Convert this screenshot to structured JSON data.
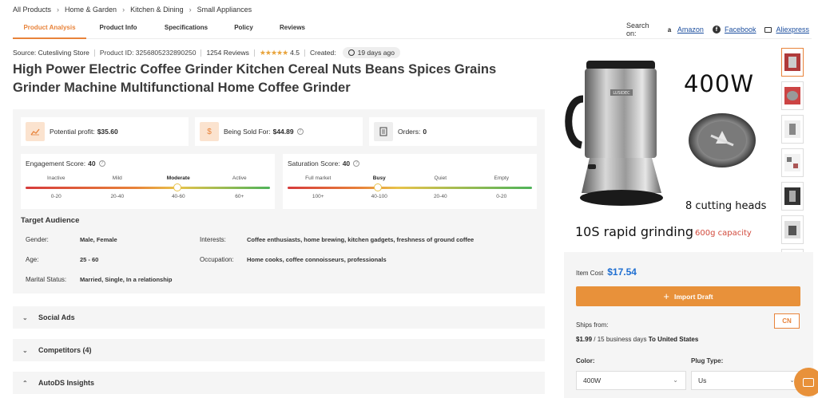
{
  "breadcrumb": [
    "All Products",
    "Home & Garden",
    "Kitchen & Dining",
    "Small Appliances"
  ],
  "tabs": [
    "Product Analysis",
    "Product Info",
    "Specifications",
    "Policy",
    "Reviews"
  ],
  "search_on": {
    "label": "Search on:",
    "links": [
      {
        "label": "Amazon",
        "icon": "amazon-icon"
      },
      {
        "label": "Facebook",
        "icon": "facebook-icon"
      },
      {
        "label": "Aliexpress",
        "icon": "mail-icon"
      }
    ]
  },
  "meta": {
    "source": "Source: Cutesliving Store",
    "product_id": "Product ID: 3256805232890250",
    "reviews": "1254 Reviews",
    "rating": "4.5",
    "stars": "★★★★★",
    "created_label": "Created:",
    "created_value": "19 days ago"
  },
  "title": "High Power Electric Coffee Grinder Kitchen Cereal Nuts Beans Spices Grains Grinder Machine Multifunctional Home Coffee Grinder",
  "stats": {
    "profit_label": "Potential profit:",
    "profit_value": "$35.60",
    "sold_label": "Being Sold For:",
    "sold_value": "$44.89",
    "orders_label": "Orders:",
    "orders_value": "0",
    "dollar_sign": "$"
  },
  "engagement": {
    "label": "Engagement Score:",
    "value": "40",
    "levels": [
      "Inactive",
      "Mild",
      "Moderate",
      "Active"
    ],
    "ranges": [
      "0-20",
      "20-40",
      "40-60",
      "60+"
    ],
    "selected_index": 2,
    "level": 0.62
  },
  "saturation": {
    "label": "Saturation Score:",
    "value": "40",
    "levels": [
      "Full market",
      "Busy",
      "Quiet",
      "Empty"
    ],
    "ranges": [
      "100+",
      "40-100",
      "20-40",
      "0-20"
    ],
    "selected_index": 1,
    "level": 0.37
  },
  "target": {
    "title": "Target Audience",
    "gender_label": "Gender:",
    "gender_value": "Male, Female",
    "age_label": "Age:",
    "age_value": "25 - 60",
    "marital_label": "Marital Status:",
    "marital_value": "Married, Single, In a relationship",
    "interests_label": "Interests:",
    "interests_value": "Coffee enthusiasts, home brewing, kitchen gadgets, freshness of ground coffee",
    "occupation_label": "Occupation:",
    "occupation_value": "Home cooks, coffee connoisseurs, professionals"
  },
  "accordions": [
    "Social Ads",
    "Competitors (4)",
    "AutoDS Insights"
  ],
  "hero": {
    "watts": "400W",
    "cutting": "8 cutting heads",
    "rapid": "10S rapid grinding",
    "capacity": "600g capacity",
    "brand_plate": "LUSIDEC"
  },
  "purchase": {
    "item_cost_label": "Item Cost",
    "item_cost_value": "$17.54",
    "import_label": "Import Draft",
    "ships_from_label": "Ships from:",
    "cn_label": "CN",
    "ship_price": "$1.99",
    "ship_days": "/ 15 business days",
    "ship_to": "To United States",
    "color_label": "Color:",
    "color_value": "400W",
    "plug_label": "Plug Type:",
    "plug_value": "Us"
  },
  "colors": {
    "accent": "#e8833a",
    "price_blue": "#1f6fd1",
    "panel_bg": "#f5f5f5"
  }
}
